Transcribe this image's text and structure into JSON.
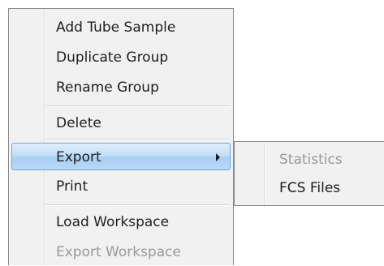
{
  "context_menu": {
    "items": [
      {
        "label": "Add Tube Sample",
        "enabled": true
      },
      {
        "label": "Duplicate Group",
        "enabled": true
      },
      {
        "label": "Rename Group",
        "enabled": true
      },
      {
        "label": "Delete",
        "enabled": true
      },
      {
        "label": "Export",
        "enabled": true,
        "highlighted": true,
        "has_submenu": true
      },
      {
        "label": "Print",
        "enabled": true
      },
      {
        "label": "Load Workspace",
        "enabled": true
      },
      {
        "label": "Export Workspace",
        "enabled": false
      }
    ]
  },
  "export_submenu": {
    "items": [
      {
        "label": "Statistics",
        "enabled": false
      },
      {
        "label": "FCS Files",
        "enabled": true
      }
    ]
  },
  "colors": {
    "menu_background": "#f1f1f1",
    "highlight_border": "#6ea6d8",
    "highlight_fill": "#b9d8f6",
    "disabled_text": "#9a9a9a"
  }
}
